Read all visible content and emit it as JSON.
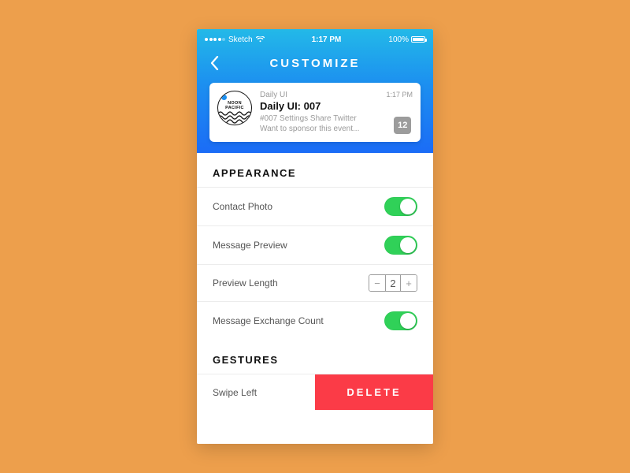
{
  "status": {
    "carrier": "Sketch",
    "time": "1:17 PM",
    "battery": "100%"
  },
  "nav": {
    "title": "CUSTOMIZE"
  },
  "card": {
    "avatar_line1": "NOON",
    "avatar_line2": "PACIFIC",
    "sender": "Daily UI",
    "time": "1:17 PM",
    "subject": "Daily UI: 007",
    "preview_l1": "#007 Settings Share Twitter",
    "preview_l2": "Want to sponsor this event...",
    "count": "12"
  },
  "sections": {
    "appearance": {
      "title": "APPEARANCE",
      "rows": {
        "contact_photo": "Contact Photo",
        "message_preview": "Message Preview",
        "preview_length": "Preview Length",
        "preview_length_value": "2",
        "message_exchange": "Message Exchange Count"
      }
    },
    "gestures": {
      "title": "GESTURES",
      "swipe_left": "Swipe Left",
      "delete": "DELETE"
    }
  }
}
